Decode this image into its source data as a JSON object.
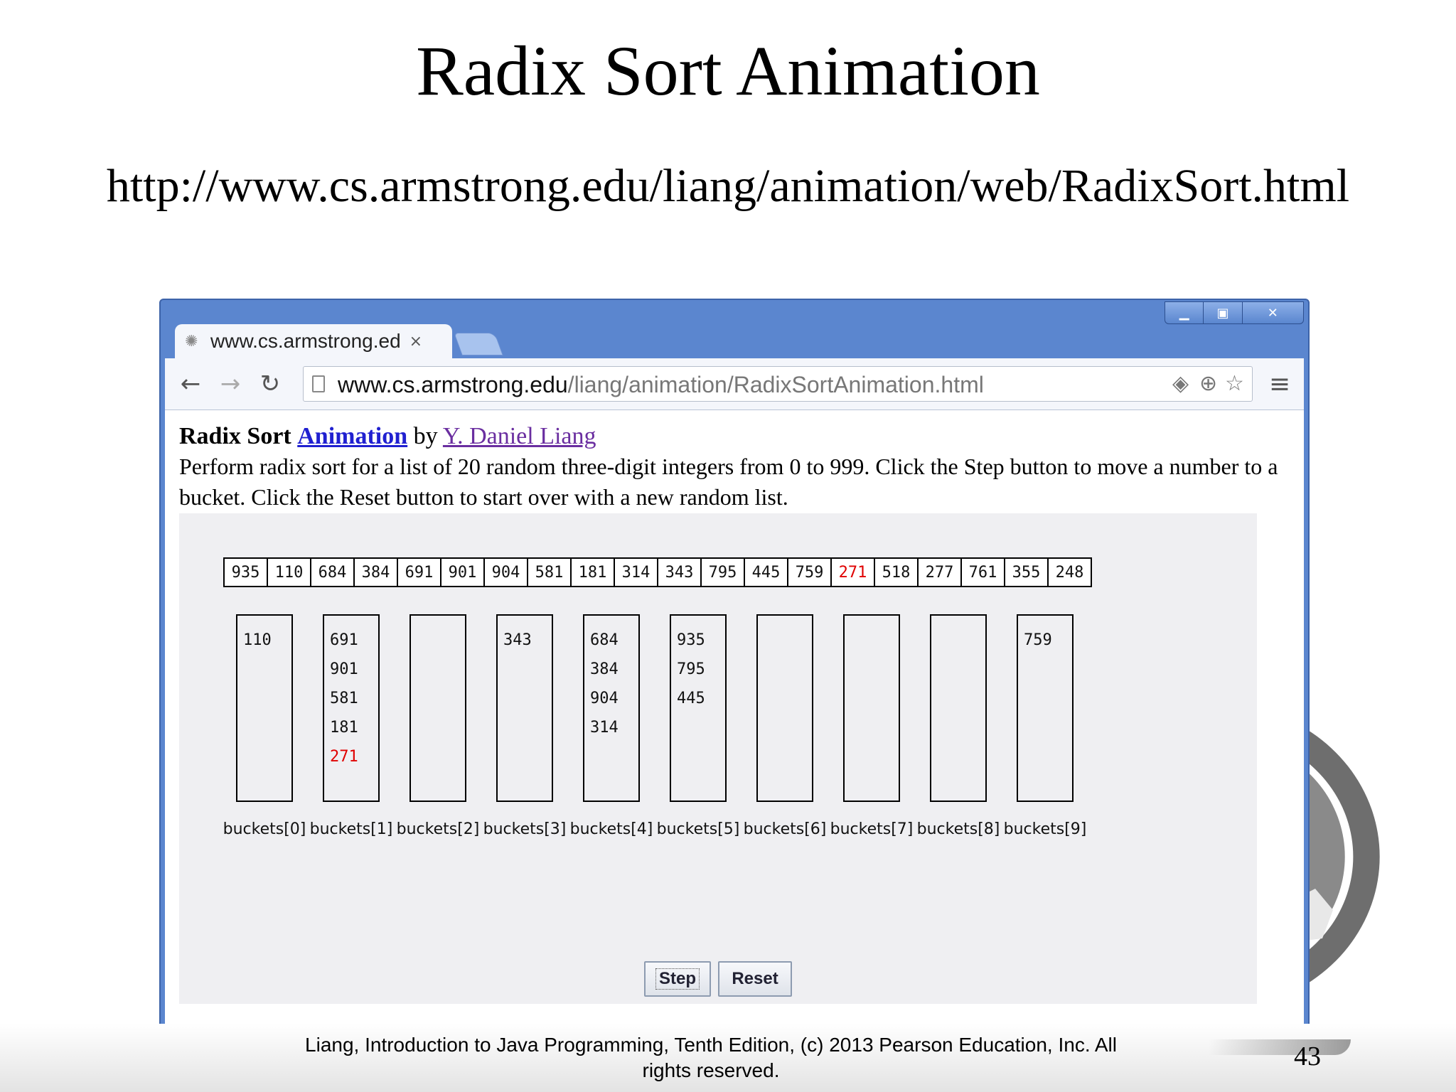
{
  "slide": {
    "title": "Radix Sort Animation",
    "url": "http://www.cs.armstrong.edu/liang/animation/web/RadixSort.html",
    "footer": "Liang, Introduction to Java Programming, Tenth Edition, (c) 2013 Pearson Education, Inc. All rights reserved.",
    "page_number": "43"
  },
  "browser": {
    "tab_title": "www.cs.armstrong.ed",
    "tab_close": "×",
    "window_controls": [
      "minimize-icon",
      "maximize-icon",
      "close-icon"
    ],
    "url_host": "www.cs.armstrong.edu",
    "url_path": "/liang/animation/RadixSortAnimation.html",
    "nav_icons": [
      "back-arrow-icon",
      "forward-arrow-icon",
      "reload-icon",
      "page-icon",
      "translate-icon",
      "zoom-icon",
      "star-icon",
      "menu-icon"
    ]
  },
  "page": {
    "heading_bold": "Radix Sort",
    "heading_link": "Animation",
    "heading_by": "by",
    "author_link": "Y. Daniel Liang",
    "description": "Perform radix sort for a list of 20 random three-digit integers from 0 to 999. Click the Step button to move a number to a bucket. Click the Reset button to start over with a new random list."
  },
  "applet": {
    "list": [
      "935",
      "110",
      "684",
      "384",
      "691",
      "901",
      "904",
      "581",
      "181",
      "314",
      "343",
      "795",
      "445",
      "759",
      "271",
      "518",
      "277",
      "761",
      "355",
      "248"
    ],
    "list_highlight_index": 14,
    "highlight_color": "#e00000",
    "buckets": [
      {
        "label": "buckets[0]",
        "items": [
          "110"
        ]
      },
      {
        "label": "buckets[1]",
        "items": [
          "691",
          "901",
          "581",
          "181",
          "271"
        ]
      },
      {
        "label": "buckets[2]",
        "items": []
      },
      {
        "label": "buckets[3]",
        "items": [
          "343"
        ]
      },
      {
        "label": "buckets[4]",
        "items": [
          "684",
          "384",
          "904",
          "314"
        ]
      },
      {
        "label": "buckets[5]",
        "items": [
          "935",
          "795",
          "445"
        ]
      },
      {
        "label": "buckets[6]",
        "items": []
      },
      {
        "label": "buckets[7]",
        "items": []
      },
      {
        "label": "buckets[8]",
        "items": []
      },
      {
        "label": "buckets[9]",
        "items": [
          "759"
        ]
      }
    ],
    "highlight_bucket": 1,
    "highlight_bucket_item": 4,
    "step_label": "Step",
    "reset_label": "Reset"
  }
}
